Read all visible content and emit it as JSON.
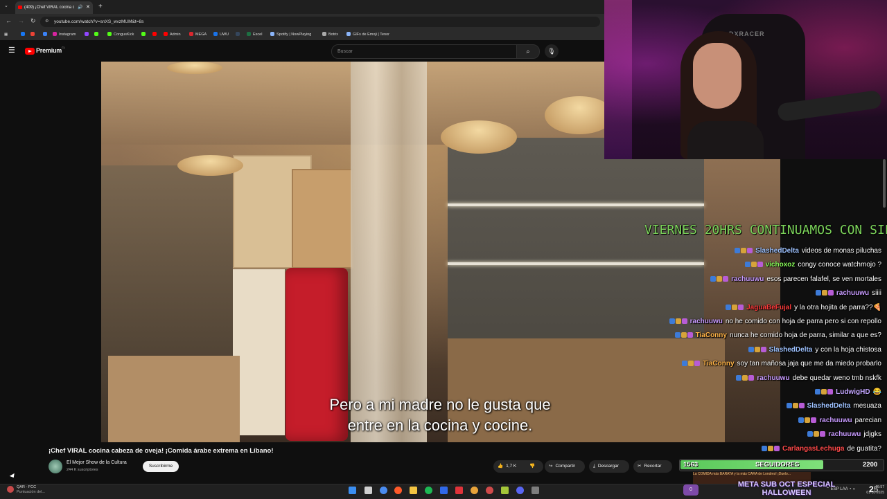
{
  "browser": {
    "tab_title": "(409) ¡Chef VIRAL cocina ca...",
    "url": "youtube.com/watch?v=snXS_wvzMUM&t=8s",
    "bookmarks": [
      "Instagram",
      "CongusKick",
      "Admin",
      "MEGA",
      "UWU",
      "Excel",
      "Spotify | NowPlaying",
      "Botrix",
      "GIFs de Emoji | Tenor"
    ]
  },
  "youtube": {
    "brand": "Premium",
    "region": "CL",
    "search_placeholder": "Buscar"
  },
  "video": {
    "subtitle_line1": "Pero a mi madre no le gusta que",
    "subtitle_line2": "entre en la cocina y cocine.",
    "title": "¡Chef VIRAL cocina cabeza de oveja! ¡Comida árabe extrema en Líbano!",
    "channel": "El Mejor Show de la Cultura",
    "subscribers": "244 K suscriptores",
    "subscribe_label": "Suscribirme",
    "likes": "1,7 K",
    "share_label": "Compartir",
    "download_label": "Descargar",
    "clip_label": "Recortar"
  },
  "webcam": {
    "chair_brand": "DXRACER"
  },
  "stream_overlay": {
    "ticker": "VIERNES 20HRS CONTINUAMOS CON SIL",
    "chat": [
      {
        "user": "SlashedDelta",
        "color": "#9ec2ff",
        "message": "videos de monas piluchas"
      },
      {
        "user": "vichoxoz",
        "color": "#8aff5a",
        "message": "congy conoce watchmojo ?"
      },
      {
        "user": "rachuuwu",
        "color": "#c89bff",
        "message": "esos parecen falafel, se ven mortales"
      },
      {
        "user": "rachuuwu",
        "color": "#c89bff",
        "message": "siiii"
      },
      {
        "user": "JaguaBeFujal",
        "color": "#ff3b3b",
        "message": "y la otra hojita de parra??🍕"
      },
      {
        "user": "rachuuwu",
        "color": "#c89bff",
        "message": "no he comido con hoja de parra pero si con repollo"
      },
      {
        "user": "TiaConny",
        "color": "#ffb347",
        "message": "nunca he comido hoja de parra, similar a que es?"
      },
      {
        "user": "SlashedDelta",
        "color": "#9ec2ff",
        "message": "y con la hoja chistosa"
      },
      {
        "user": "TiaConny",
        "color": "#ffb347",
        "message": "soy tan mañosa jaja que me da miedo probarlo"
      },
      {
        "user": "rachuuwu",
        "color": "#c89bff",
        "message": "debe quedar weno tmb nskfk"
      },
      {
        "user": "LudwigHD",
        "color": "#c3a6ff",
        "message": "😂"
      },
      {
        "user": "SlashedDelta",
        "color": "#9ec2ff",
        "message": "mesuaza"
      },
      {
        "user": "rachuuwu",
        "color": "#c89bff",
        "message": "parecian"
      },
      {
        "user": "rachuuwu",
        "color": "#c89bff",
        "message": "jdjgks"
      },
      {
        "user": "CarlangasLechuga",
        "color": "#ff4a4a",
        "message": "de guatita?"
      }
    ],
    "followers_current": "1563",
    "followers_label": "SEGUIDORES",
    "followers_goal": "2200",
    "followers_progress": 0.71,
    "promo_text": "La COMIDA más BARATA y la más CARA de Londres! ¡Duelo...",
    "meta_line1": "META SUB OCT ESPECIAL",
    "meta_line2": "HALLOWEEN",
    "meta_badge": "0",
    "meta_count": "2",
    "meta_count_suffix": "5"
  },
  "taskbar": {
    "weather_title": "QAR - FCC",
    "weather_sub": "Puntuación del...",
    "tray": "ESP LAA",
    "time": "15:57",
    "date": "01-10-2025"
  }
}
